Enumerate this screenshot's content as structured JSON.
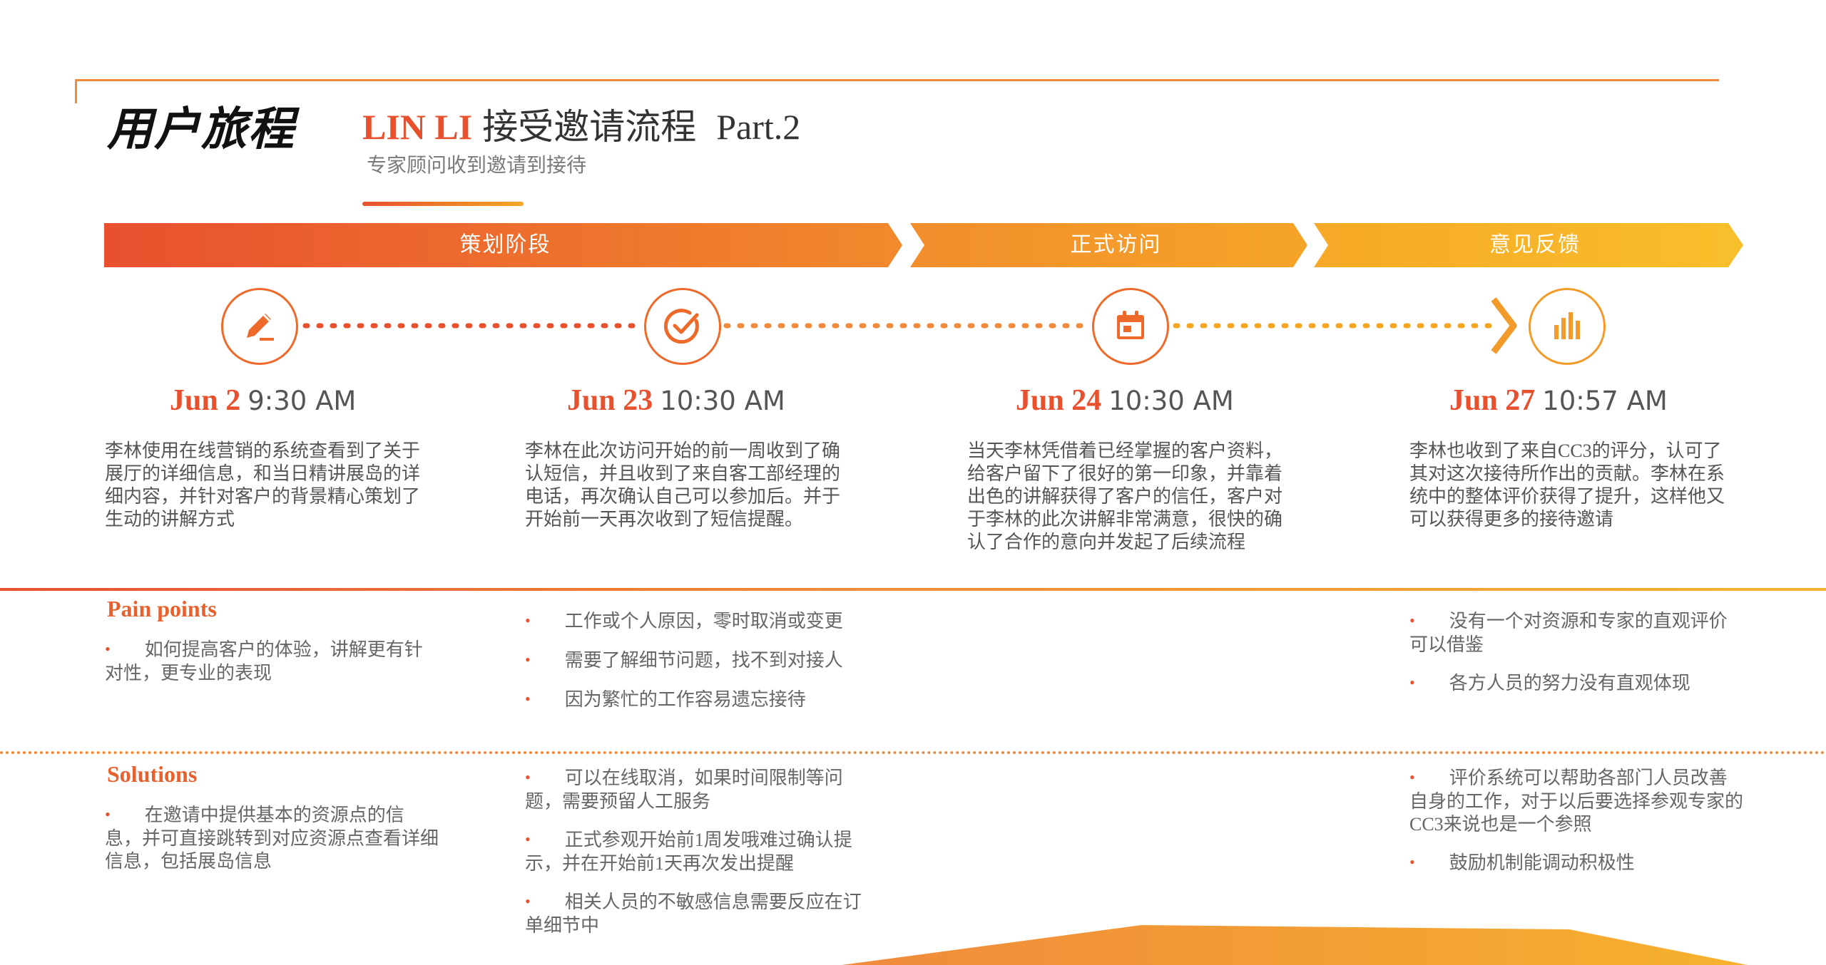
{
  "header": {
    "page_title": "用户旅程",
    "subtitle_name": "LIN LI",
    "subtitle_text": "接受邀请流程",
    "subtitle_part": "Part.2",
    "subheading": "专家顾问收到邀请到接待"
  },
  "phases": [
    {
      "label": "策划阶段"
    },
    {
      "label": "正式访问"
    },
    {
      "label": "意见反馈"
    }
  ],
  "colors": {
    "accent_red": "#e8502e",
    "accent_orange": "#f08a3c",
    "accent_yellow": "#f6b12e"
  },
  "timeline": [
    {
      "icon": "pencil-icon",
      "date": "Jun 2",
      "time": "9:30 AM",
      "desc": "李林使用在线营销的系统查看到了关于展厅的详细信息，和当日精讲展岛的详细内容，并针对客户的背景精心策划了生动的讲解方式"
    },
    {
      "icon": "check-circle-icon",
      "date": "Jun 23",
      "time": "10:30 AM",
      "desc": "李林在此次访问开始的前一周收到了确认短信，并且收到了来自客工部经理的电话，再次确认自己可以参加后。并于开始前一天再次收到了短信提醒。"
    },
    {
      "icon": "calendar-icon",
      "date": "Jun 24",
      "time": "10:30 AM",
      "desc": "当天李林凭借着已经掌握的客户资料，给客户留下了很好的第一印象，并靠着出色的讲解获得了客户的信任，客户对于李林的此次讲解非常满意，很快的确认了合作的意向并发起了后续流程"
    },
    {
      "icon": "bar-chart-icon",
      "date": "Jun 27",
      "time": "10:57 AM",
      "desc": "李林也收到了来自CC3的评分，认可了其对这次接待所作出的贡献。李林在系统中的整体评价获得了提升，这样他又可以获得更多的接待邀请"
    }
  ],
  "pain_points": {
    "label": "Pain points",
    "col1": [
      "如何提高客户的体验，讲解更有针对性，更专业的表现"
    ],
    "col2": [
      "工作或个人原因，零时取消或变更",
      "需要了解细节问题，找不到对接人",
      "因为繁忙的工作容易遗忘接待"
    ],
    "col4": [
      "没有一个对资源和专家的直观评价可以借鉴",
      "各方人员的努力没有直观体现"
    ]
  },
  "solutions": {
    "label": "Solutions",
    "col1": [
      "在邀请中提供基本的资源点的信息，并可直接跳转到对应资源点查看详细信息，包括展岛信息"
    ],
    "col2": [
      "可以在线取消，如果时间限制等问题，需要预留人工服务",
      "正式参观开始前1周发哦难过确认提示，并在开始前1天再次发出提醒",
      "相关人员的不敏感信息需要反应在订单细节中"
    ],
    "col4": [
      "评价系统可以帮助各部门人员改善自身的工作，对于以后要选择参观专家的CC3来说也是一个参照",
      "鼓励机制能调动积极性"
    ]
  }
}
